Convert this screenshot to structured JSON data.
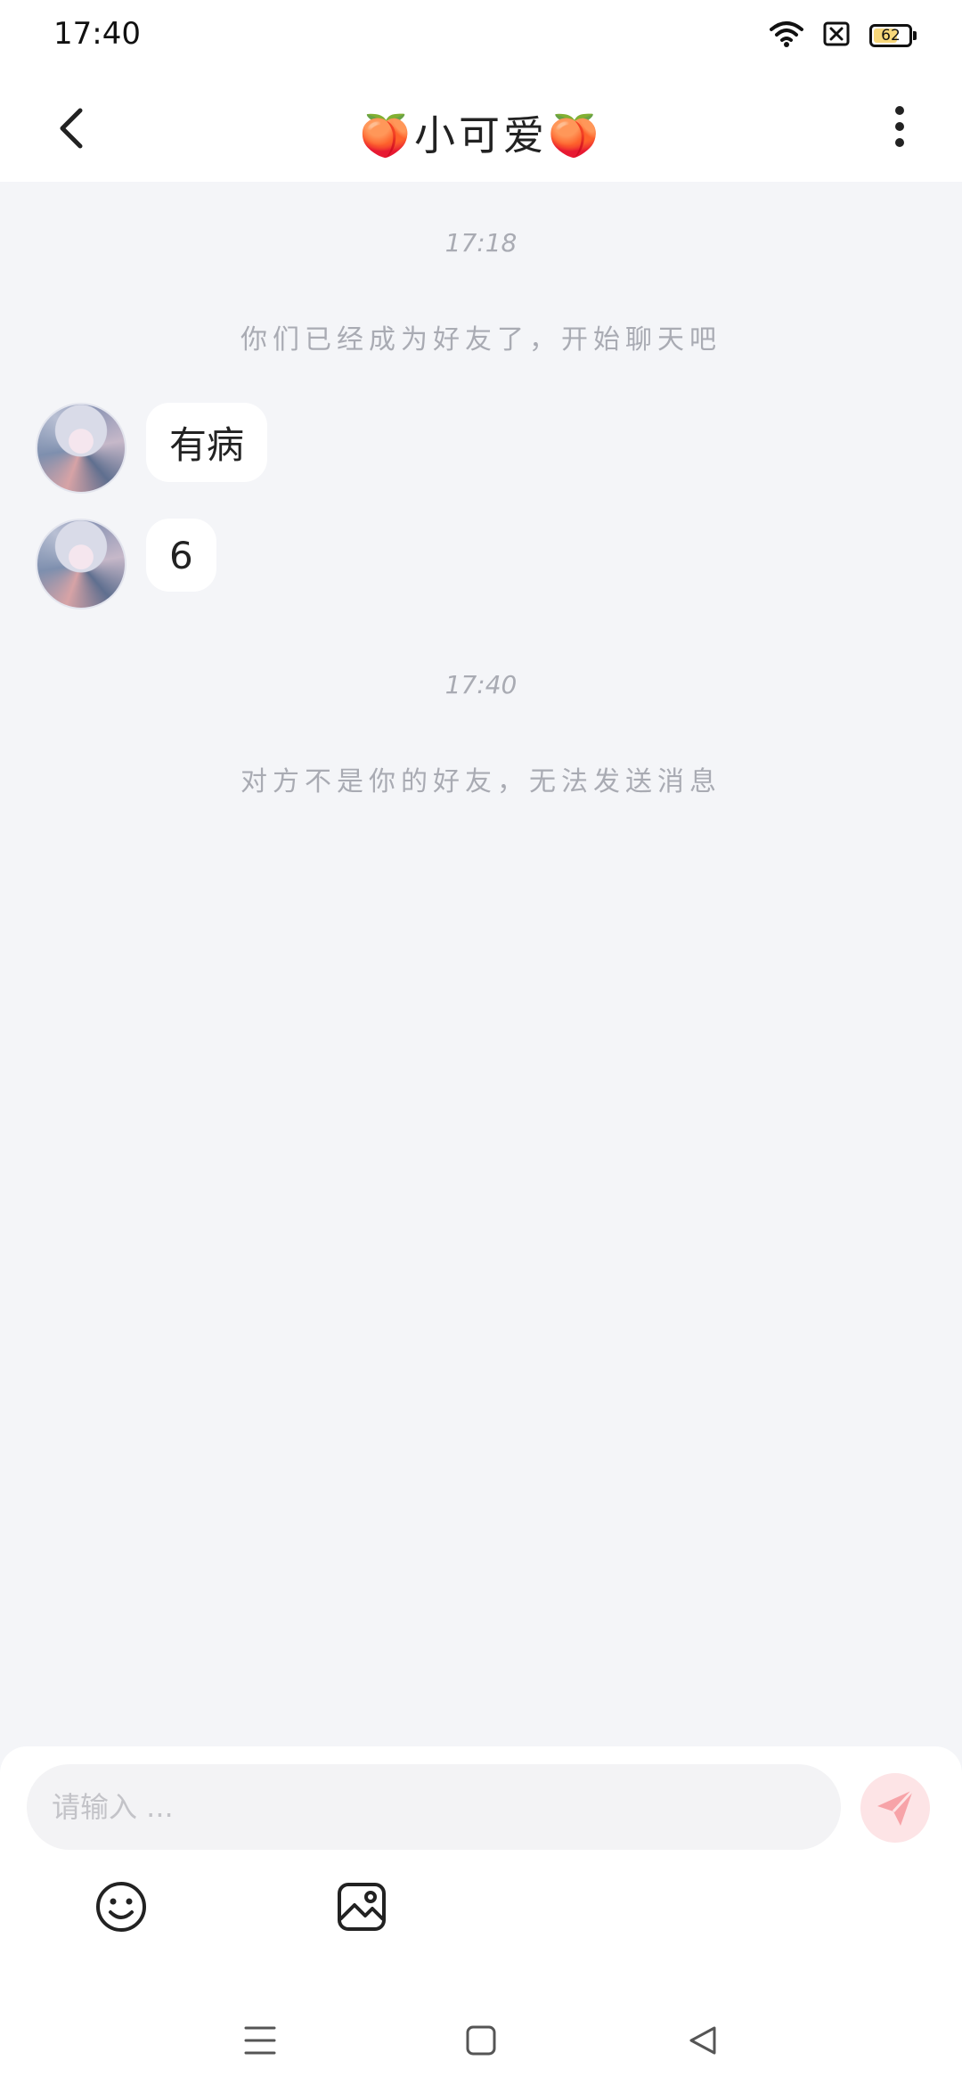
{
  "status_bar": {
    "time": "17:40",
    "battery_level": "62",
    "icons": [
      "wifi-icon",
      "sim-off-icon",
      "battery-icon"
    ]
  },
  "header": {
    "title": "🍑小可爱🍑",
    "back_icon": "chevron-left-icon",
    "more_icon": "more-vertical-icon"
  },
  "chat": {
    "timestamp_1": "17:18",
    "system_message_1": "你们已经成为好友了，开始聊天吧",
    "messages": [
      {
        "text": "有病",
        "sender": "other"
      },
      {
        "text": "6",
        "sender": "other"
      }
    ],
    "timestamp_2": "17:40",
    "system_message_2": "对方不是你的好友，无法发送消息"
  },
  "composer": {
    "placeholder": "请输入 ...",
    "value": "",
    "send_icon": "send-icon",
    "emoji_icon": "emoji-icon",
    "image_icon": "image-icon"
  },
  "colors": {
    "chat_background": "#f4f5f8",
    "send_button_bg": "#fde4e6",
    "send_icon": "#f7a3a8",
    "system_text": "#a9abb3"
  }
}
